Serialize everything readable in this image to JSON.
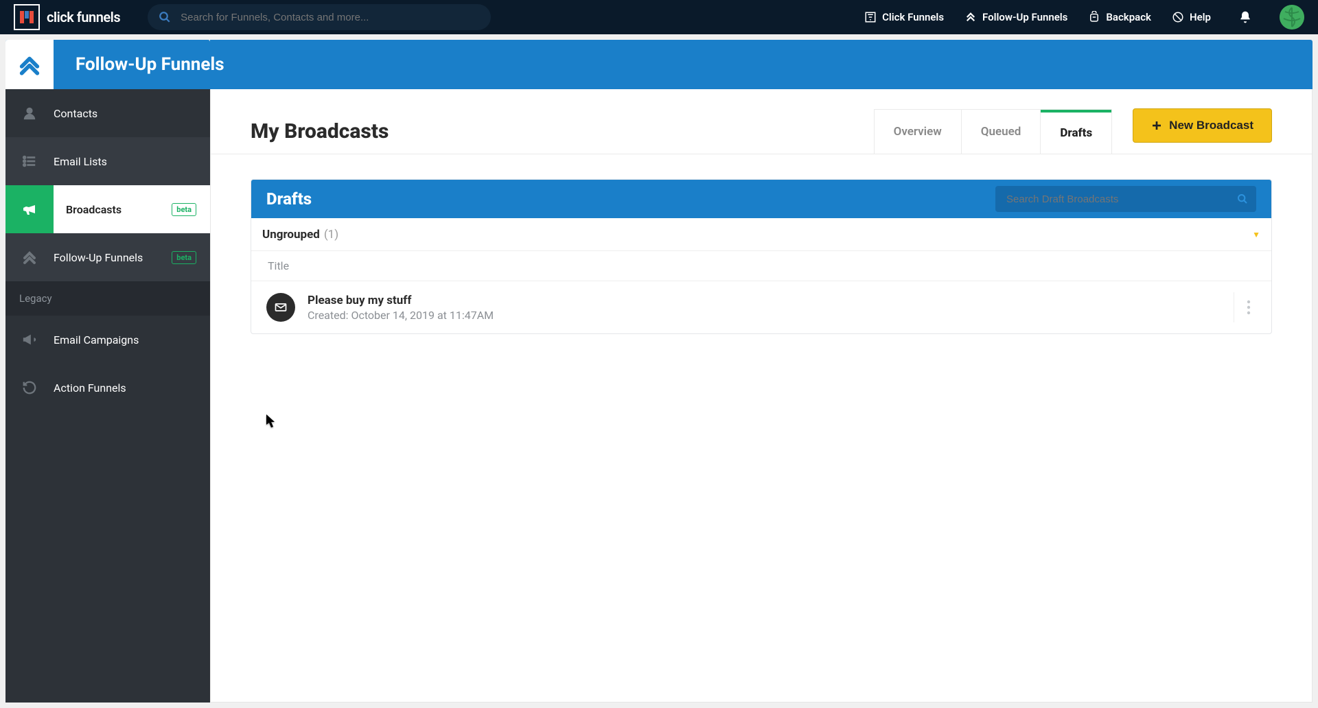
{
  "brand": {
    "name": "click funnels"
  },
  "topnav": {
    "search_placeholder": "Search for Funnels, Contacts and more...",
    "links": {
      "click_funnels": "Click Funnels",
      "follow_up": "Follow-Up Funnels",
      "backpack": "Backpack",
      "help": "Help"
    }
  },
  "page_header": {
    "title": "Follow-Up Funnels"
  },
  "sidebar": {
    "contacts": "Contacts",
    "email_lists": "Email Lists",
    "broadcasts": "Broadcasts",
    "broadcasts_badge": "beta",
    "follow_up": "Follow-Up Funnels",
    "follow_up_badge": "beta",
    "legacy_label": "Legacy",
    "email_campaigns": "Email Campaigns",
    "action_funnels": "Action Funnels"
  },
  "main": {
    "heading": "My Broadcasts",
    "tabs": {
      "overview": "Overview",
      "queued": "Queued",
      "drafts": "Drafts"
    },
    "new_button": "New Broadcast"
  },
  "panel": {
    "title": "Drafts",
    "search_placeholder": "Search Draft Broadcasts",
    "group_title": "Ungrouped",
    "group_count": "(1)",
    "column_title": "Title",
    "rows": [
      {
        "title": "Please buy my stuff",
        "created": "Created: October 14, 2019 at 11:47AM"
      }
    ]
  }
}
